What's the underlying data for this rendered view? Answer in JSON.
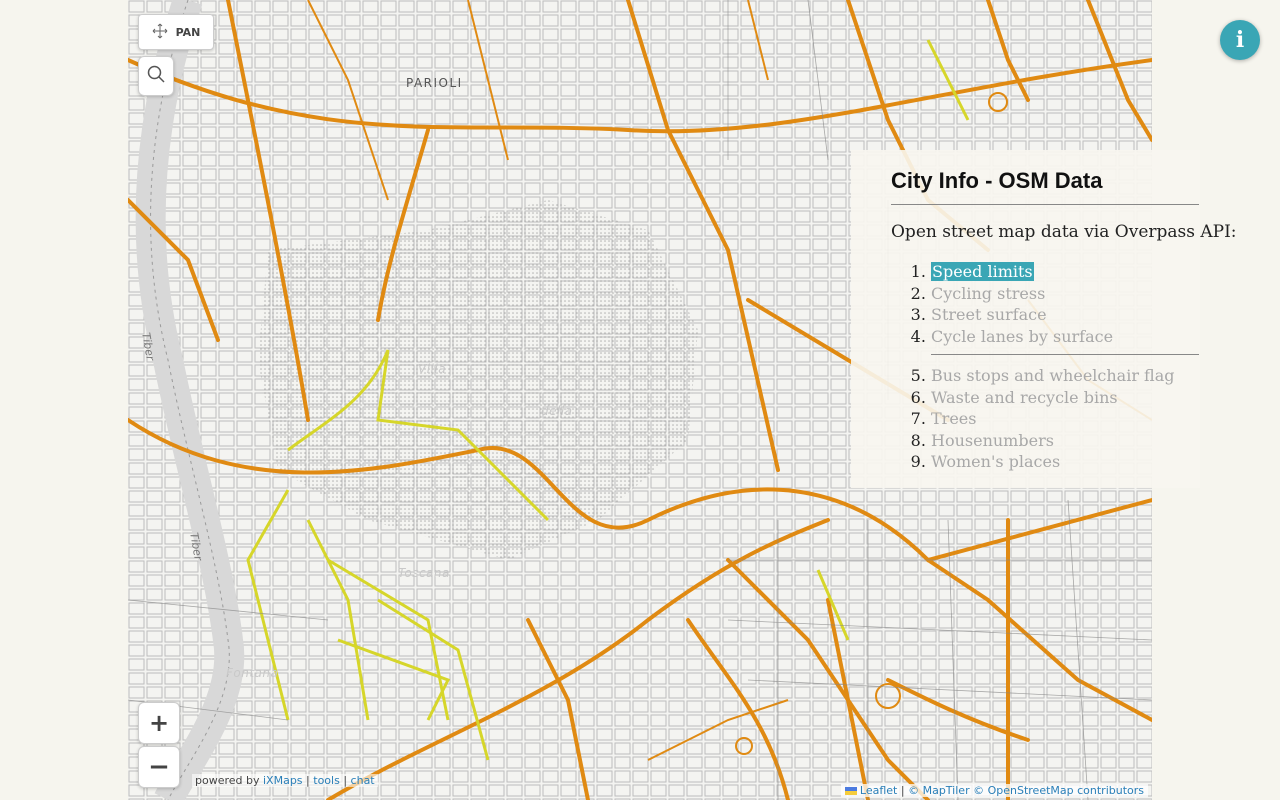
{
  "map": {
    "neighborhood_label": "PARIOLI",
    "faint_labels": [
      "Villa",
      "della",
      "Toscana",
      "Fontana"
    ],
    "river_labels": [
      "Tiber",
      "Tiber"
    ]
  },
  "controls": {
    "pan_label": "PAN",
    "zoom_in": "+",
    "zoom_out": "−",
    "info": "i"
  },
  "panel": {
    "title": "City Info - OSM Data",
    "intro": "Open street map data via Overpass API:",
    "group1": [
      {
        "label": "Speed limits",
        "active": true
      },
      {
        "label": "Cycling stress",
        "active": false
      },
      {
        "label": "Street surface",
        "active": false
      },
      {
        "label": "Cycle lanes by surface",
        "active": false
      }
    ],
    "group2": [
      {
        "label": "Bus stops and wheelchair flag"
      },
      {
        "label": "Waste and recycle bins"
      },
      {
        "label": "Trees"
      },
      {
        "label": "Housenumbers"
      },
      {
        "label": "Women's places"
      }
    ]
  },
  "attribution_left": {
    "prefix": "powered by",
    "brand": "iXMaps",
    "sep1": "|",
    "tools": "tools",
    "sep2": "|",
    "chat": "chat"
  },
  "attribution_right": {
    "leaflet": "Leaflet",
    "sep": "|",
    "maptiler": "© MapTiler",
    "osm": "© OpenStreetMap contributors"
  },
  "colors": {
    "road_major": "#e08a12",
    "road_speed_low": "#d6d62a",
    "river": "#d8d8d8",
    "accent": "#3aa6b5"
  }
}
